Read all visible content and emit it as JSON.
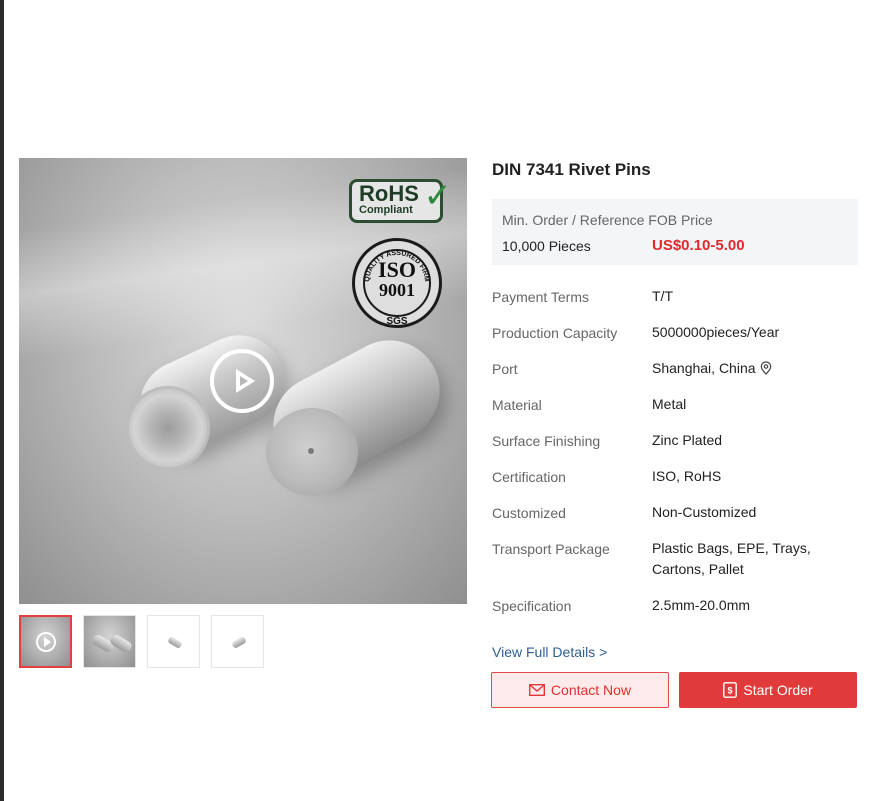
{
  "product": {
    "title": "DIN 7341 Rivet Pins"
  },
  "badges": {
    "rohs_line1": "RoHS",
    "rohs_line2": "Compliant",
    "iso_line1": "ISO",
    "iso_line2": "9001",
    "iso_ring_text": "QUALITY ASSURED FIRM",
    "iso_footer": "SGS"
  },
  "price_box": {
    "label": "Min. Order / Reference FOB Price",
    "min_order": "10,000 Pieces",
    "price": "US$0.10-5.00"
  },
  "specs": [
    {
      "label": "Payment Terms",
      "value": "T/T"
    },
    {
      "label": "Production Capacity",
      "value": "5000000pieces/Year"
    },
    {
      "label": "Port",
      "value": "Shanghai, China"
    },
    {
      "label": "Material",
      "value": "Metal"
    },
    {
      "label": "Surface Finishing",
      "value": "Zinc Plated"
    },
    {
      "label": "Certification",
      "value": "ISO, RoHS"
    },
    {
      "label": "Customized",
      "value": "Non-Customized"
    },
    {
      "label": "Transport Package",
      "value": "Plastic Bags, EPE, Trays, Cartons, Pallet"
    },
    {
      "label": "Specification",
      "value": "2.5mm-20.0mm"
    }
  ],
  "links": {
    "view_full_details": "View Full Details >"
  },
  "buttons": {
    "contact_now": "Contact Now",
    "start_order": "Start Order"
  },
  "colors": {
    "accent_red": "#e13a3a",
    "price_red": "#e0282e",
    "link_blue": "#2f5f8f",
    "active_thumb_border": "#e24040"
  },
  "icons": {
    "play": "play-icon",
    "location": "location-pin-icon",
    "mail": "mail-icon",
    "order": "order-icon"
  }
}
